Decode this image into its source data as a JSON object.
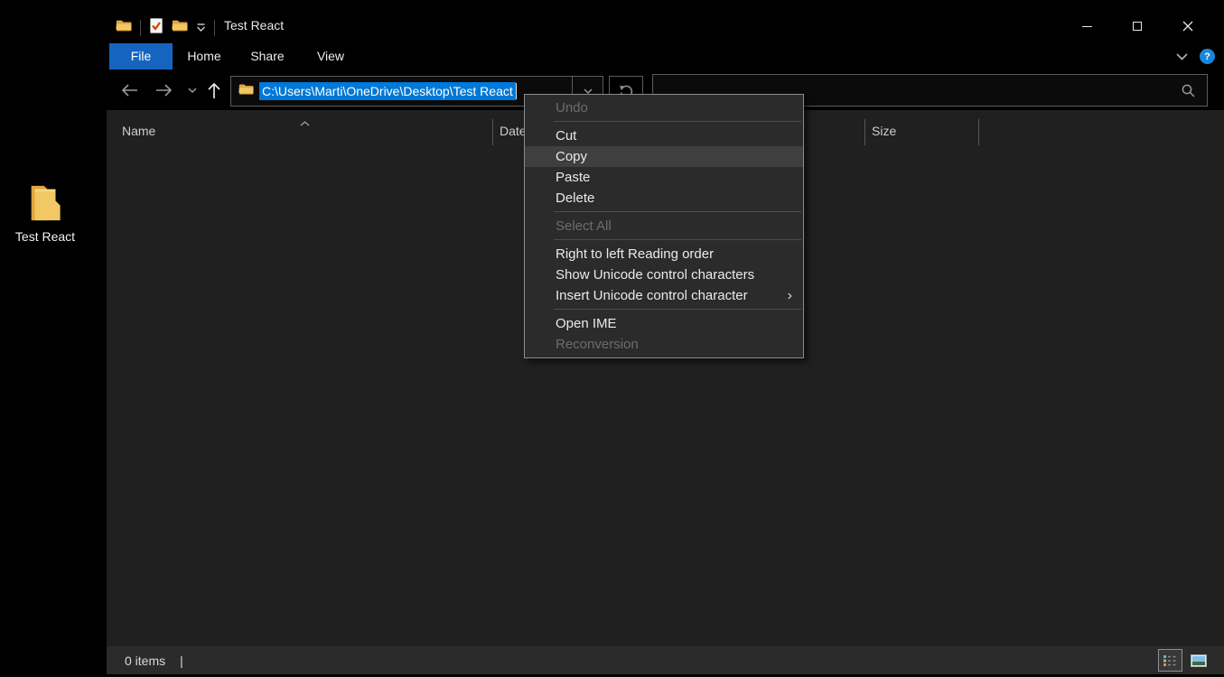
{
  "desktop": {
    "folder_label": "Test React"
  },
  "window": {
    "title": "Test React",
    "tabs": [
      {
        "label": "File",
        "active": true
      },
      {
        "label": "Home"
      },
      {
        "label": "Share"
      },
      {
        "label": "View"
      }
    ],
    "ribbon": {
      "help_glyph": "?"
    },
    "address": {
      "path": "C:\\Users\\Marti\\OneDrive\\Desktop\\Test React"
    },
    "search": {
      "value": ""
    },
    "columns": {
      "name": "Name",
      "date": "Date modified",
      "size": "Size"
    },
    "status": {
      "count": "0 items",
      "separator": "|"
    }
  },
  "context_menu": {
    "submenu_arrow": "›",
    "items": [
      {
        "label": "Undo",
        "state": "disabled"
      },
      {
        "separator": true
      },
      {
        "label": "Cut"
      },
      {
        "label": "Copy",
        "state": "highlighted"
      },
      {
        "label": "Paste"
      },
      {
        "label": "Delete"
      },
      {
        "separator": true
      },
      {
        "label": "Select All",
        "state": "disabled"
      },
      {
        "separator": true
      },
      {
        "label": "Right to left Reading order"
      },
      {
        "label": "Show Unicode control characters"
      },
      {
        "label": "Insert Unicode control character",
        "submenu": true
      },
      {
        "separator": true
      },
      {
        "label": "Open IME"
      },
      {
        "label": "Reconversion",
        "state": "disabled"
      }
    ]
  },
  "colors": {
    "selection_blue": "#0078d7",
    "file_tab_blue": "#1565c0",
    "help_blue": "#1a86d9",
    "menu_bg": "#2b2b2b",
    "menu_highlight": "#3f3f3f",
    "folder_yellow": "#f2c864"
  }
}
